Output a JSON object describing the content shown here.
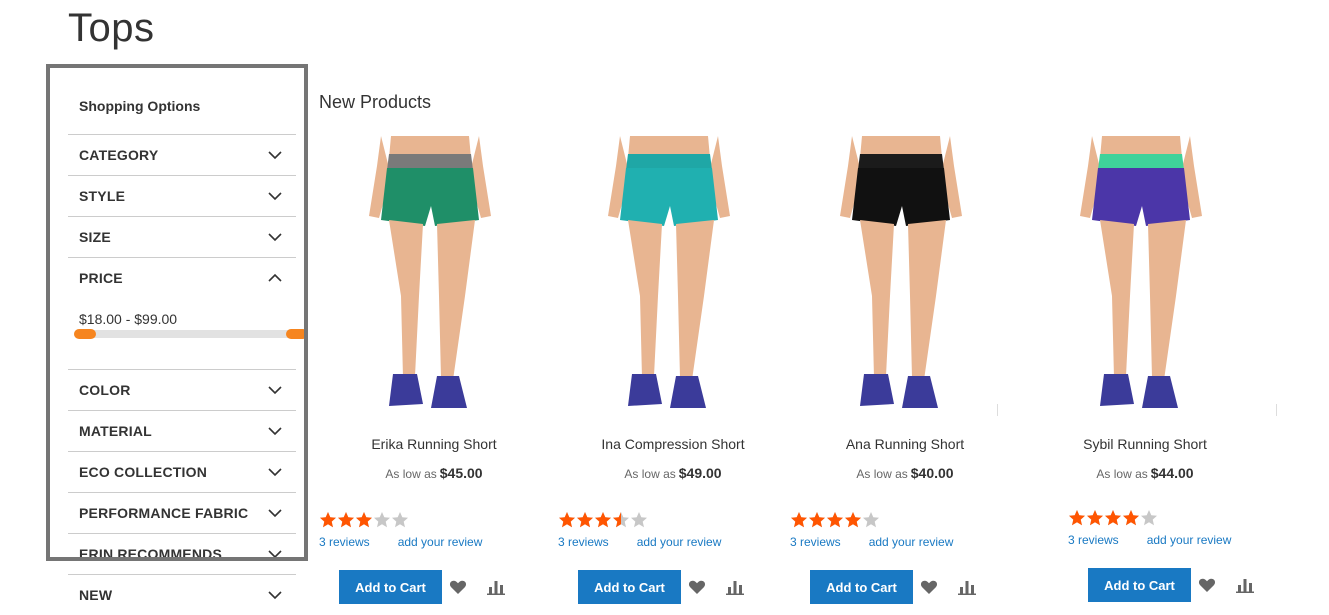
{
  "page": {
    "title": "Tops"
  },
  "filters": {
    "title": "Shopping Options",
    "items": [
      {
        "label": "CATEGORY",
        "expanded": false
      },
      {
        "label": "STYLE",
        "expanded": false
      },
      {
        "label": "SIZE",
        "expanded": false
      },
      {
        "label": "PRICE",
        "expanded": true
      },
      {
        "label": "COLOR",
        "expanded": false
      },
      {
        "label": "MATERIAL",
        "expanded": false
      },
      {
        "label": "ECO COLLECTION",
        "expanded": false
      },
      {
        "label": "PERFORMANCE FABRIC",
        "expanded": false
      },
      {
        "label": "ERIN RECOMMENDS",
        "expanded": false
      },
      {
        "label": "NEW",
        "expanded": false
      }
    ],
    "price_range": "$18.00 - $99.00",
    "accent_color": "#f6851f"
  },
  "section": {
    "title": "New Products"
  },
  "products": [
    {
      "name": "Erika Running Short",
      "price_prefix": "As low as",
      "price": "$45.00",
      "rating": 3,
      "reviews": "3  reviews",
      "add_review": "add your review",
      "add_to_cart": "Add to Cart",
      "colors": {
        "waist": "#7a7a7a",
        "short": "#1f8f68"
      }
    },
    {
      "name": "Ina Compression Short",
      "price_prefix": "As low as",
      "price": "$49.00",
      "rating": 3.5,
      "reviews": "3  reviews",
      "add_review": "add your review",
      "add_to_cart": "Add to Cart",
      "colors": {
        "waist": "#1fa7a6",
        "short": "#20b0b0"
      }
    },
    {
      "name": "Ana Running Short",
      "price_prefix": "As low as",
      "price": "$40.00",
      "rating": 4,
      "reviews": "3  reviews",
      "add_review": "add your review",
      "add_to_cart": "Add to Cart",
      "colors": {
        "waist": "#1b1b1b",
        "short": "#111111"
      }
    },
    {
      "name": "Sybil Running Short",
      "price_prefix": "As low as",
      "price": "$44.00",
      "rating": 4,
      "reviews": "3  reviews",
      "add_review": "add your review",
      "add_to_cart": "Add to Cart",
      "colors": {
        "waist": "#3fd29a",
        "short": "#4b36a8"
      }
    }
  ],
  "colors": {
    "brand": "#1979c3",
    "star": "#ff5501",
    "star_empty": "#c7c7c7"
  }
}
